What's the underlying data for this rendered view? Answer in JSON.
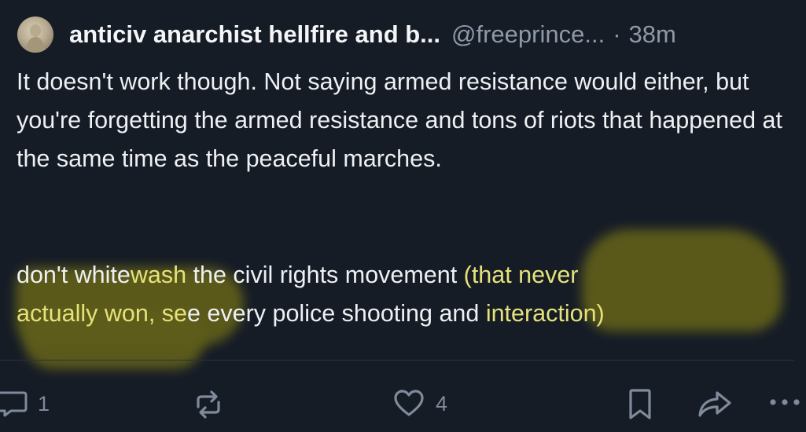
{
  "post": {
    "author": {
      "display_name": "anticiv anarchist hellfire and b...",
      "handle": "@freeprince...",
      "separator": "·",
      "time": "38m"
    },
    "body": {
      "paragraph1": "It doesn't work though. Not saying armed resistance would either, but you're forgetting the armed resistance and tons of riots that happened at the same time as the peaceful marches.",
      "line1_a": "don't white",
      "line1_b": "wash",
      "line1_c": " the civil rights movement ",
      "line1_d": "(that never",
      "line2_a": "actually won, se",
      "line2_b": "e every police shooting and ",
      "line2_c": "interaction)"
    },
    "actions": {
      "reply_icon": "reply-icon",
      "reply_count": "1",
      "repost_icon": "repost-icon",
      "like_icon": "heart-icon",
      "like_count": "4",
      "bookmark_icon": "bookmark-icon",
      "share_icon": "share-icon",
      "more_icon": "more-icon"
    },
    "colors": {
      "background": "#161c26",
      "text": "#eef0f3",
      "muted": "#8e99a8",
      "highlight": "#5e5d1a"
    }
  }
}
